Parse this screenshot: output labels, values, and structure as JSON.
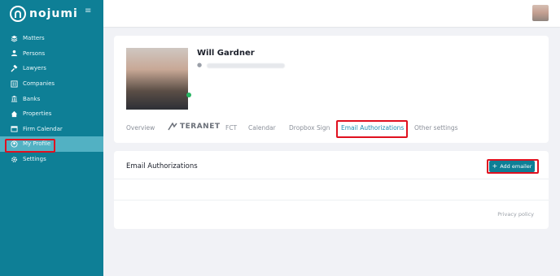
{
  "app": {
    "brand": "nojumi"
  },
  "sidebar": {
    "items": [
      {
        "label": "Matters",
        "icon": "layers-icon"
      },
      {
        "label": "Persons",
        "icon": "person-icon"
      },
      {
        "label": "Lawyers",
        "icon": "gavel-icon"
      },
      {
        "label": "Companies",
        "icon": "building-icon"
      },
      {
        "label": "Banks",
        "icon": "bank-icon"
      },
      {
        "label": "Properties",
        "icon": "house-icon"
      },
      {
        "label": "Firm Calendar",
        "icon": "calendar-icon"
      },
      {
        "label": "My Profile",
        "icon": "profile-icon",
        "active": true
      },
      {
        "label": "Settings",
        "icon": "gear-icon"
      }
    ]
  },
  "profile": {
    "name": "Will Gardner"
  },
  "tabs": [
    {
      "label": "Overview"
    },
    {
      "label": "TERANET"
    },
    {
      "label": "FCT"
    },
    {
      "label": "Calendar"
    },
    {
      "label": "Dropbox Sign"
    },
    {
      "label": "Email Authorizations",
      "active": true
    },
    {
      "label": "Other settings"
    }
  ],
  "email_auth": {
    "title": "Email Authorizations",
    "add_button": "Add emailer",
    "privacy": "Privacy policy"
  },
  "colors": {
    "sidebar": "#0e7f96",
    "active_item": "#52b1c3",
    "accent": "#1f8fb3",
    "highlight": "#e0101f"
  }
}
